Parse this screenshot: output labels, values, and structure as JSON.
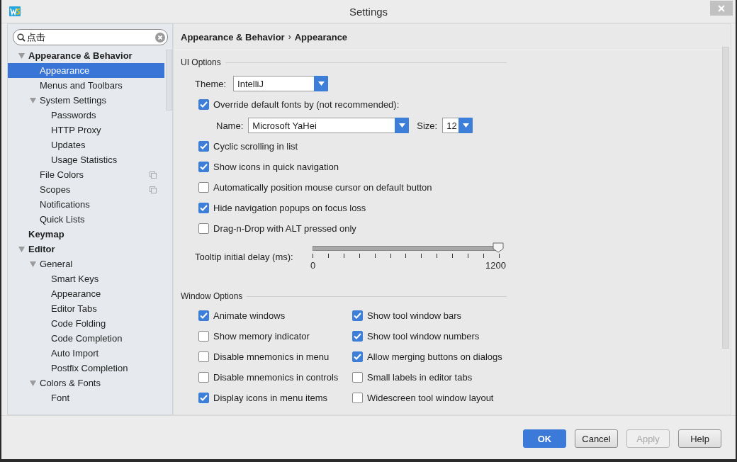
{
  "window": {
    "title": "Settings"
  },
  "search": {
    "value": "点击"
  },
  "tree": [
    {
      "label": "Appearance & Behavior",
      "expanded": true,
      "selected": false,
      "children": [
        {
          "label": "Appearance",
          "selected": true
        },
        {
          "label": "Menus and Toolbars",
          "selected": false
        },
        {
          "label": "System Settings",
          "expanded": true,
          "selected": false,
          "children": [
            {
              "label": "Passwords",
              "selected": false
            },
            {
              "label": "HTTP Proxy",
              "selected": false
            },
            {
              "label": "Updates",
              "selected": false
            },
            {
              "label": "Usage Statistics",
              "selected": false
            }
          ]
        },
        {
          "label": "File Colors",
          "selected": false,
          "project_scope": true
        },
        {
          "label": "Scopes",
          "selected": false,
          "project_scope": true
        },
        {
          "label": "Notifications",
          "selected": false
        },
        {
          "label": "Quick Lists",
          "selected": false
        }
      ]
    },
    {
      "label": "Keymap",
      "selected": false
    },
    {
      "label": "Editor",
      "expanded": true,
      "selected": false,
      "children": [
        {
          "label": "General",
          "expanded": true,
          "selected": false,
          "children": [
            {
              "label": "Smart Keys",
              "selected": false
            },
            {
              "label": "Appearance",
              "selected": false
            },
            {
              "label": "Editor Tabs",
              "selected": false
            },
            {
              "label": "Code Folding",
              "selected": false
            },
            {
              "label": "Code Completion",
              "selected": false
            },
            {
              "label": "Auto Import",
              "selected": false
            },
            {
              "label": "Postfix Completion",
              "selected": false
            }
          ]
        },
        {
          "label": "Colors & Fonts",
          "expanded": true,
          "selected": false,
          "children": [
            {
              "label": "Font",
              "selected": false
            }
          ]
        }
      ]
    }
  ],
  "breadcrumb": [
    "Appearance & Behavior",
    "Appearance"
  ],
  "breadcrumb_separator": "›",
  "ui_options": {
    "title": "UI Options",
    "theme": {
      "label": "Theme:",
      "value": "IntelliJ"
    },
    "override_fonts": {
      "label": "Override default fonts by (not recommended):",
      "checked": true
    },
    "font_name": {
      "label": "Name:",
      "value": "Microsoft YaHei"
    },
    "font_size": {
      "label": "Size:",
      "value": "12"
    },
    "checkboxes": [
      {
        "label": "Cyclic scrolling in list",
        "checked": true
      },
      {
        "label": "Show icons in quick navigation",
        "checked": true
      },
      {
        "label": "Automatically position mouse cursor on default button",
        "checked": false
      },
      {
        "label": "Hide navigation popups on focus loss",
        "checked": true
      },
      {
        "label": "Drag-n-Drop with ALT pressed only",
        "checked": false
      }
    ],
    "tooltip_delay": {
      "label": "Tooltip initial delay (ms):",
      "level": 1.0,
      "min_label": "0",
      "max_label": "1200"
    }
  },
  "window_options": {
    "title": "Window Options",
    "checkboxes": [
      {
        "label": "Animate windows",
        "checked": true
      },
      {
        "label": "Show tool window bars",
        "checked": true
      },
      {
        "label": "Show memory indicator",
        "checked": false
      },
      {
        "label": "Show tool window numbers",
        "checked": true
      },
      {
        "label": "Disable mnemonics in menu",
        "checked": false
      },
      {
        "label": "Allow merging buttons on dialogs",
        "checked": true
      },
      {
        "label": "Disable mnemonics in controls",
        "checked": false
      },
      {
        "label": "Small labels in editor tabs",
        "checked": false
      },
      {
        "label": "Display icons in menu items",
        "checked": true
      },
      {
        "label": "Widescreen tool window layout",
        "checked": false
      }
    ]
  },
  "buttons": [
    {
      "label": "OK",
      "kind": "primary",
      "disabled": false
    },
    {
      "label": "Cancel",
      "kind": "normal",
      "disabled": false
    },
    {
      "label": "Apply",
      "kind": "normal",
      "disabled": true
    },
    {
      "label": "Help",
      "kind": "normal",
      "disabled": false
    }
  ]
}
